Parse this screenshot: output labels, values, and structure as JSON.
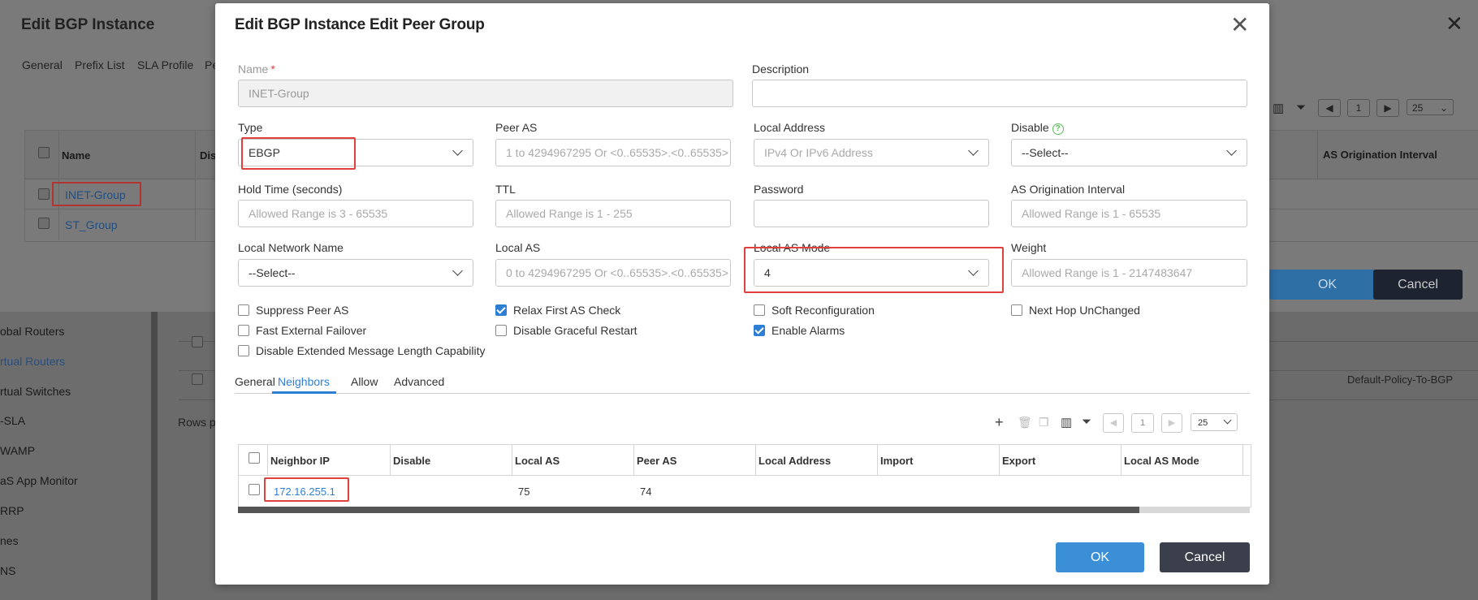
{
  "background": {
    "sidebar_items": [
      {
        "label": "obal Routers",
        "active": false
      },
      {
        "label": "rtual Routers",
        "active": true
      },
      {
        "label": "rtual Switches",
        "active": false
      },
      {
        "label": "-SLA",
        "active": false
      },
      {
        "label": "WAMP",
        "active": false
      },
      {
        "label": "aS App Monitor",
        "active": false
      },
      {
        "label": "RRP",
        "active": false
      },
      {
        "label": "nes",
        "active": false
      },
      {
        "label": "NS",
        "active": false
      }
    ],
    "rows_per_page_label": "Rows p",
    "policy_text": "Default-Policy-To-BGP"
  },
  "back_dialog": {
    "title": "Edit BGP Instance",
    "tabs": [
      "General",
      "Prefix List",
      "SLA Profile",
      "Pe"
    ],
    "columns": [
      "Name",
      "Dis"
    ],
    "right_column": "AS Origination Interval",
    "rows": [
      "INET-Group",
      "ST_Group"
    ],
    "page": "1",
    "page_size": "25",
    "ok_label": "OK",
    "cancel_label": "Cancel"
  },
  "modal": {
    "title": "Edit BGP Instance Edit Peer Group",
    "close_glyph": "✕",
    "fields": {
      "name": {
        "label": "Name",
        "value": "INET-Group"
      },
      "description": {
        "label": "Description",
        "value": ""
      },
      "type": {
        "label": "Type",
        "value": "EBGP"
      },
      "peer_as": {
        "label": "Peer AS",
        "placeholder": "1 to 4294967295 Or <0..65535>.<0..65535>"
      },
      "local_address": {
        "label": "Local Address",
        "placeholder": "IPv4 Or IPv6 Address"
      },
      "disable": {
        "label": "Disable",
        "value": "--Select--"
      },
      "hold_time": {
        "label": "Hold Time (seconds)",
        "placeholder": "Allowed Range is 3 - 65535"
      },
      "ttl": {
        "label": "TTL",
        "placeholder": "Allowed Range is 1 - 255"
      },
      "password": {
        "label": "Password",
        "value": ""
      },
      "as_origination": {
        "label": "AS Origination Interval",
        "placeholder": "Allowed Range is 1 - 65535"
      },
      "local_network_name": {
        "label": "Local Network Name",
        "value": "--Select--"
      },
      "local_as": {
        "label": "Local AS",
        "placeholder": "0 to 4294967295 Or <0..65535>.<0..65535>"
      },
      "local_as_mode": {
        "label": "Local AS Mode",
        "value": "4"
      },
      "weight": {
        "label": "Weight",
        "placeholder": "Allowed Range is 1 - 2147483647"
      }
    },
    "checkboxes": [
      {
        "label": "Suppress Peer AS",
        "checked": false
      },
      {
        "label": "Relax First AS Check",
        "checked": true
      },
      {
        "label": "Soft Reconfiguration",
        "checked": false
      },
      {
        "label": "Next Hop UnChanged",
        "checked": false
      },
      {
        "label": "Fast External Failover",
        "checked": false
      },
      {
        "label": "Disable Graceful Restart",
        "checked": false
      },
      {
        "label": "Enable Alarms",
        "checked": true
      },
      {
        "label": "Disable Extended Message Length Capability",
        "checked": false
      }
    ],
    "tabs": [
      "General",
      "Neighbors",
      "Allow",
      "Advanced"
    ],
    "active_tab": "Neighbors",
    "pager": {
      "page": "1",
      "size": "25"
    },
    "grid": {
      "columns": [
        "Neighbor IP",
        "Disable",
        "Local AS",
        "Peer AS",
        "Local Address",
        "Import",
        "Export",
        "Local AS Mode"
      ],
      "rows": [
        {
          "neighbor_ip": "172.16.255.1",
          "disable": "",
          "local_as": "75",
          "peer_as": "74",
          "local_address": "",
          "import": "",
          "export": "",
          "local_as_mode": ""
        }
      ]
    },
    "ok_label": "OK",
    "cancel_label": "Cancel"
  },
  "colors": {
    "accent": "#2d7fd4",
    "highlight": "#e0403c",
    "ok": "#3a8fd6",
    "cancel": "#3a3f4b"
  }
}
